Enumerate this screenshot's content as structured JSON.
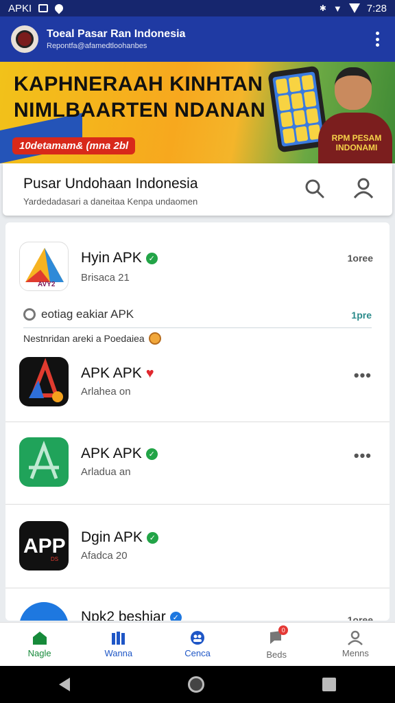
{
  "status_bar": {
    "left_text": "APKI",
    "time": "7:28"
  },
  "app_bar": {
    "title": "Toeal Pasar Ran Indonesia",
    "subtitle": "Repontfa@afamedtloohanbes"
  },
  "banner": {
    "line1": "KAPHNERAAH KINHTAN",
    "line2": "NIMLBAARTEN NDANAN",
    "pill_text": "10detamam& (mna 2bl",
    "side_text": "RPM PESAM INDONAMI",
    "tag_text": "MNA 2BL"
  },
  "header": {
    "title": "Pusar Undohaan Indonesia",
    "subtitle": "Yardedadasari a daneitaa Kenpa undaomen"
  },
  "apps": [
    {
      "name": "Hyin APK",
      "meta": "Brisaca 21",
      "badge": "check",
      "action": "1oree"
    },
    {
      "name": "APK APK",
      "meta": "Arlahea on",
      "badge": "heart",
      "action": "•••"
    },
    {
      "name": "APK APK",
      "meta": "Arladua an",
      "badge": "check",
      "action": "•••"
    },
    {
      "name": "Dgin APK",
      "meta": "Afadca 20",
      "badge": "check",
      "action": ""
    },
    {
      "name": "Npk2 beshiar",
      "meta": "",
      "badge": "check-blue",
      "action": "1oree"
    }
  ],
  "section": {
    "label": "eotiag eakiar APK",
    "right": "1pre",
    "note": "Nestnridan areki a Poedaiea"
  },
  "bottom_nav": [
    {
      "label": "Nagle",
      "icon": "home-icon"
    },
    {
      "label": "Wanna",
      "icon": "library-icon"
    },
    {
      "label": "Cenca",
      "icon": "people-icon"
    },
    {
      "label": "Beds",
      "icon": "notification-icon",
      "badge": "0"
    },
    {
      "label": "Menns",
      "icon": "profile-icon"
    }
  ],
  "colors": {
    "primary": "#1f3aa3",
    "accent_green": "#168a3a",
    "status_bar": "#16266e"
  }
}
